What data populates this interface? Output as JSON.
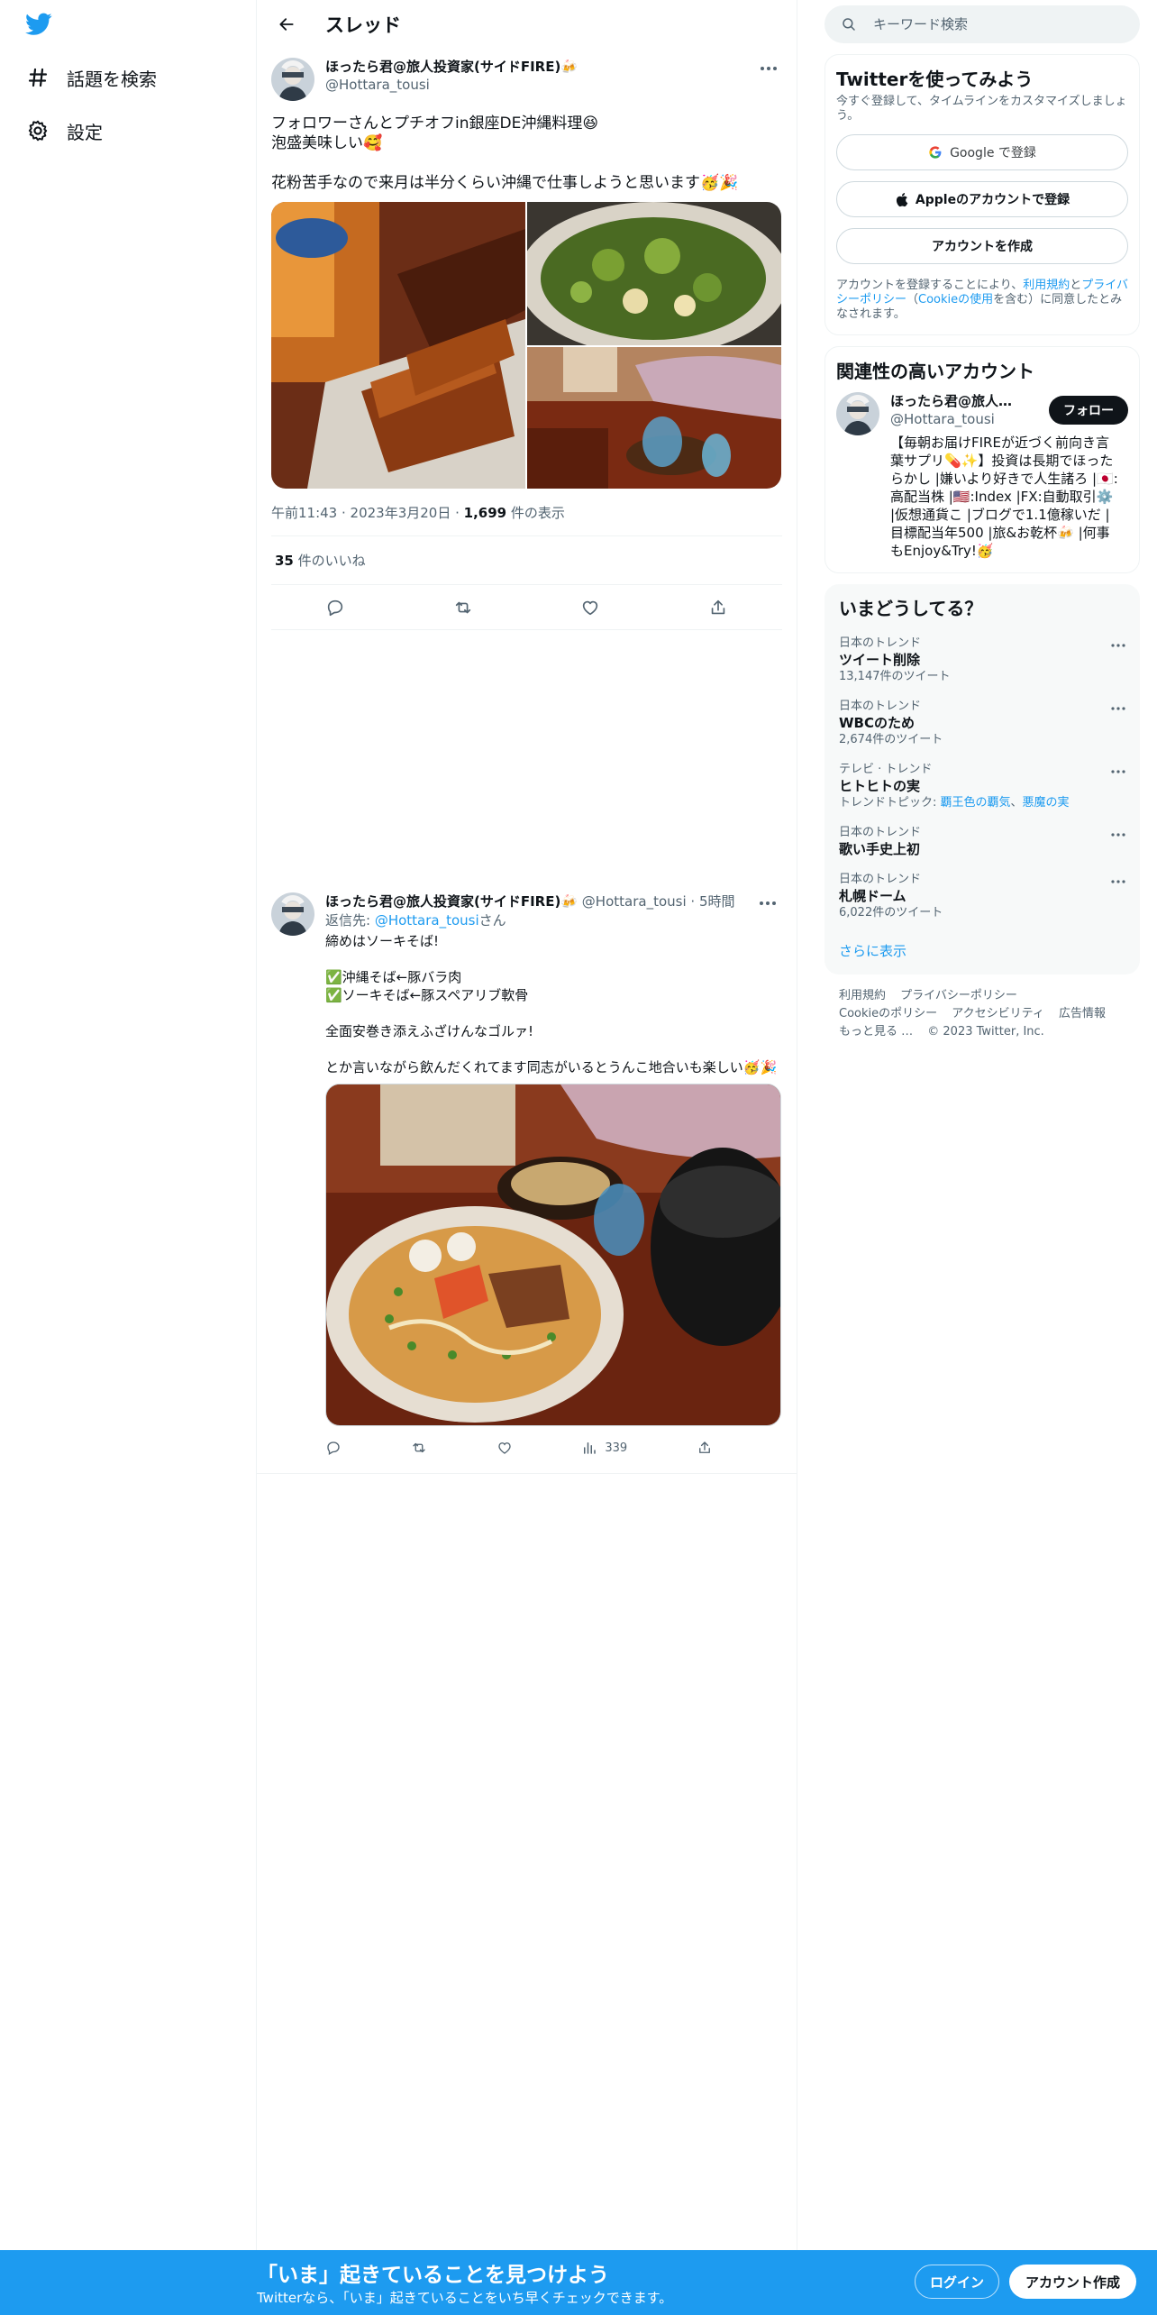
{
  "nav": {
    "items": [
      {
        "label": "話題を検索",
        "icon": "hashtag-icon"
      },
      {
        "label": "設定",
        "icon": "gear-icon"
      }
    ]
  },
  "header": {
    "title": "スレッド"
  },
  "tweet": {
    "display_name": "ほったら君@旅人投資家(サイドFIRE)🍻",
    "handle": "@Hottara_tousi",
    "text": "フォロワーさんとプチオフin銀座DE沖縄料理😆\n泡盛美味しい🥰\n\n花粉苦手なので来月は半分くらい沖縄で仕事しようと思います🥳🎉",
    "time": "午前11:43",
    "date": "2023年3月20日",
    "views": "1,699",
    "views_label": " 件の表示",
    "likes": "35",
    "likes_label": " 件のいいね"
  },
  "reply": {
    "display_name": "ほったら君@旅人投資家(サイドFIRE)🍻",
    "handle": "@Hottara_tousi",
    "time": "5時間",
    "replying_prefix": "返信先: ",
    "replying_to": "@Hottara_tousi",
    "replying_suffix": "さん",
    "text": "締めはソーキそば!\n\n✅沖縄そば←豚バラ肉\n✅ソーキそば←豚スペアリブ軟骨\n\n全面安巻き添えふざけんなゴルァ!\n\nとか言いながら飲んだくれてます同志がいるとうんこ地合いも楽しい🥳🎉",
    "views": "339"
  },
  "search": {
    "placeholder": "キーワード検索"
  },
  "signup_card": {
    "title": "Twitterを使ってみよう",
    "subtitle": "今すぐ登録して、タイムラインをカスタマイズしましょう。",
    "google": "Google で登録",
    "apple": "Appleのアカウントで登録",
    "create": "アカウントを作成",
    "legal_1": "アカウントを登録することにより、",
    "legal_terms": "利用規約",
    "legal_2": "と",
    "legal_privacy": "プライバシーポリシー",
    "legal_3": "（",
    "legal_cookie": "Cookieの使用",
    "legal_4": "を含む）に同意したとみなされます。"
  },
  "related": {
    "title": "関連性の高いアカウント",
    "name": "ほったら君@旅人投...",
    "handle": "@Hottara_tousi",
    "follow": "フォロー",
    "bio": "【毎朝お届けFIREが近づく前向き言葉サプリ💊✨】投資は長期でほったらかし |嫌いより好きで人生諸ろ |🇯🇵:高配当株 |🇺🇸:Index |FX:自動取引⚙️ |仮想通貨こ |ブログで1.1億稼いだ |目標配当年500 |旅&お乾杯🍻 |何事もEnjoy&Try!🥳"
  },
  "trends": {
    "title": "いまどうしてる？",
    "items": [
      {
        "context": "日本のトレンド",
        "name": "ツイート削除",
        "count": "13,147件のツイート"
      },
      {
        "context": "日本のトレンド",
        "name": "WBCのため",
        "count": "2,674件のツイート"
      },
      {
        "context": "テレビ · トレンド",
        "name": "ヒトヒトの実",
        "count_prefix": "トレンドトピック: ",
        "topic_1": "覇王色の覇気",
        "topic_sep": "、",
        "topic_2": "悪魔の実"
      },
      {
        "context": "日本のトレンド",
        "name": "歌い手史上初"
      },
      {
        "context": "日本のトレンド",
        "name": "札幌ドーム",
        "count": "6,022件のツイート"
      }
    ],
    "show_more": "さらに表示"
  },
  "footer": {
    "links": [
      "利用規約",
      "プライバシーポリシー",
      "Cookieのポリシー",
      "アクセシビリティ",
      "広告情報",
      "もっと見る …"
    ],
    "copyright": "© 2023 Twitter, Inc."
  },
  "bottom": {
    "title": "「いま」起きていることを見つけよう",
    "subtitle": "Twitterなら、「いま」起きていることをいち早くチェックできます。",
    "login": "ログイン",
    "signup": "アカウント作成"
  },
  "colors": {
    "accent": "#1d9bf0",
    "text": "#0f1419",
    "muted": "#536471"
  }
}
